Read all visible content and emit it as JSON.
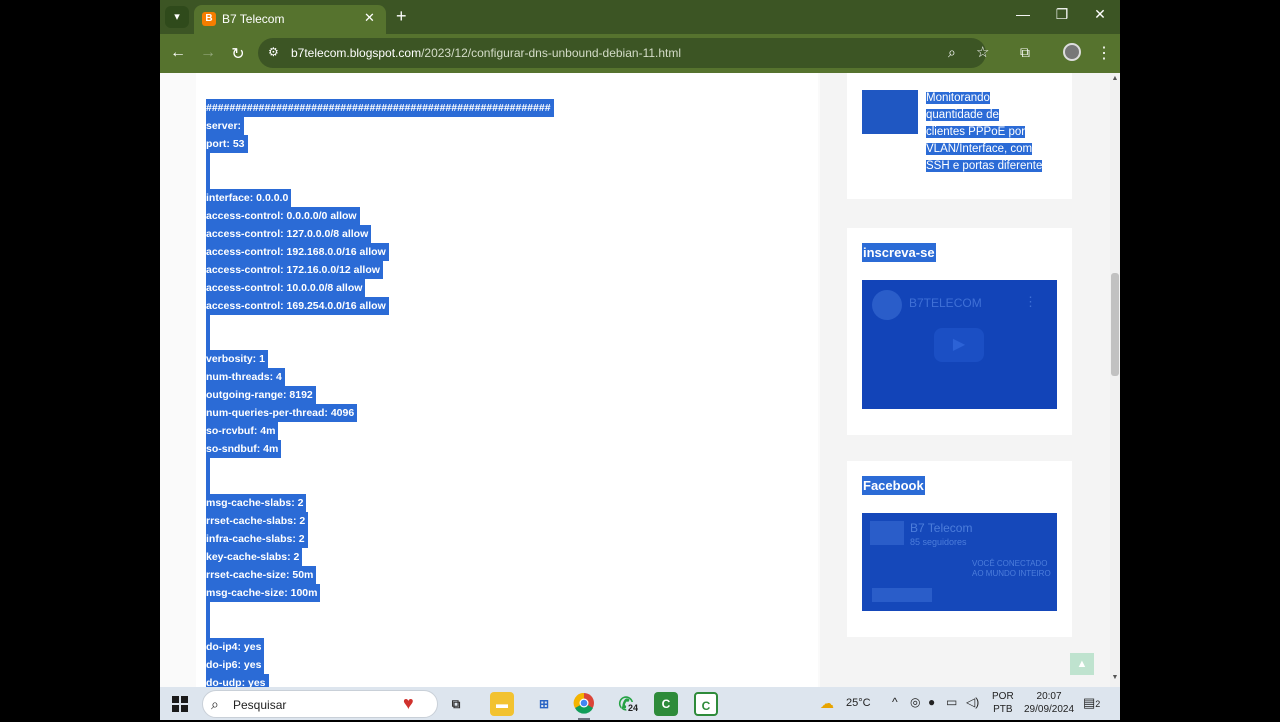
{
  "browser": {
    "tab_title": "B7 Telecom",
    "url_host": "b7telecom.blogspot.com",
    "url_path": "/2023/12/configurar-dns-unbound-debian-11.html",
    "new_tab": "+",
    "tab_close": "✕",
    "min_icon": "—",
    "max_icon": "❐",
    "close_icon": "✕"
  },
  "code_lines": [
    "###########################################################",
    "server:",
    "port: 53",
    "",
    "interface: 0.0.0.0",
    "access-control: 0.0.0.0/0 allow",
    "access-control: 127.0.0.0/8 allow",
    "access-control: 192.168.0.0/16 allow",
    "access-control: 172.16.0.0/12 allow",
    "access-control: 10.0.0.0/8 allow",
    "access-control: 169.254.0.0/16 allow",
    "",
    "verbosity: 1",
    "num-threads: 4",
    "outgoing-range: 8192",
    "num-queries-per-thread: 4096",
    "so-rcvbuf: 4m",
    "so-sndbuf: 4m",
    "",
    "msg-cache-slabs: 2",
    "rrset-cache-slabs: 2",
    "infra-cache-slabs: 2",
    "key-cache-slabs: 2",
    "rrset-cache-size: 50m",
    "msg-cache-size: 100m",
    "",
    "do-ip4: yes",
    "do-ip6: yes",
    "do-udp: yes"
  ],
  "sidebar": {
    "popular_post_lines": [
      "Monitorando",
      "quantidade de",
      "clientes PPPoE por",
      "VLAN/Interface, com",
      "SSH e portas diferente"
    ],
    "subscribe_title": "inscreva-se",
    "youtube_channel": "B7TELECOM",
    "facebook_title": "Facebook",
    "facebook_page": "B7 Telecom",
    "facebook_followers": "85 seguidores",
    "facebook_tagline": "VOCÊ CONECTADO AO MUNDO INTEIRO"
  },
  "taskbar": {
    "search_placeholder": "Pesquisar",
    "whatsapp_badge": "24",
    "temperature": "25°C",
    "lang_line1": "POR",
    "lang_line2": "PTB",
    "time": "20:07",
    "date": "29/09/2024",
    "notifications": "2"
  },
  "colors": {
    "browser_frame": "#3c5524",
    "toolbar": "#56732e",
    "selection": "#2b6bd6"
  }
}
